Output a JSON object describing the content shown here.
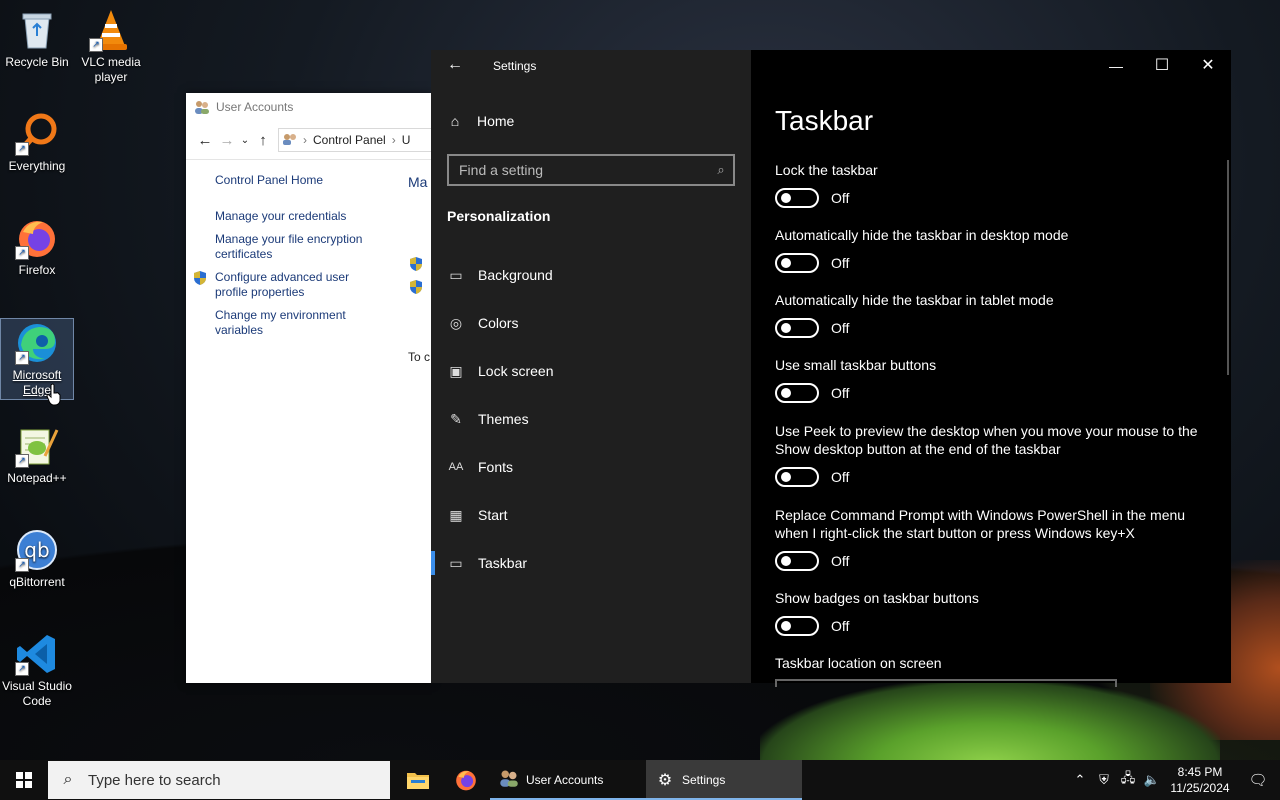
{
  "desktop": {
    "icons": [
      {
        "label": "Recycle Bin"
      },
      {
        "label": "VLC media player"
      },
      {
        "label": "Everything"
      },
      {
        "label": "Firefox"
      },
      {
        "label": "Microsoft Edge"
      },
      {
        "label": "Notepad++"
      },
      {
        "label": "qBittorrent"
      },
      {
        "label": "Visual Studio Code"
      }
    ]
  },
  "user_accounts": {
    "title": "User Accounts",
    "address": "Control Panel",
    "address_tail": "U",
    "links": {
      "home": "Control Panel Home",
      "credentials": "Manage your credentials",
      "encryption": "Manage your file encryption certificates",
      "advanced_profile": "Configure advanced user profile properties",
      "env_vars": "Change my environment variables"
    },
    "right_heading": "Ma",
    "right_text": "To c"
  },
  "settings": {
    "title": "Settings",
    "home_label": "Home",
    "search_placeholder": "Find a setting",
    "category": "Personalization",
    "nav": [
      {
        "label": "Background"
      },
      {
        "label": "Colors"
      },
      {
        "label": "Lock screen"
      },
      {
        "label": "Themes"
      },
      {
        "label": "Fonts"
      },
      {
        "label": "Start"
      },
      {
        "label": "Taskbar"
      }
    ],
    "page_title": "Taskbar",
    "options": [
      {
        "label": "Lock the taskbar",
        "state": "Off"
      },
      {
        "label": "Automatically hide the taskbar in desktop mode",
        "state": "Off"
      },
      {
        "label": "Automatically hide the taskbar in tablet mode",
        "state": "Off"
      },
      {
        "label": "Use small taskbar buttons",
        "state": "Off"
      },
      {
        "label": "Use Peek to preview the desktop when you move your mouse to the Show desktop button at the end of the taskbar",
        "state": "Off"
      },
      {
        "label": "Replace Command Prompt with Windows PowerShell in the menu when I right-click the start button or press Windows key+X",
        "state": "Off"
      },
      {
        "label": "Show badges on taskbar buttons",
        "state": "Off"
      }
    ],
    "location_label": "Taskbar location on screen"
  },
  "taskbar": {
    "search_placeholder": "Type here to search",
    "apps": [
      {
        "label": "User Accounts"
      },
      {
        "label": "Settings"
      }
    ],
    "time": "8:45 PM",
    "date": "11/25/2024"
  },
  "colors": {
    "accent": "#3b8eea",
    "settings_sidebar": "#1f1f1f",
    "settings_content": "#000000"
  }
}
